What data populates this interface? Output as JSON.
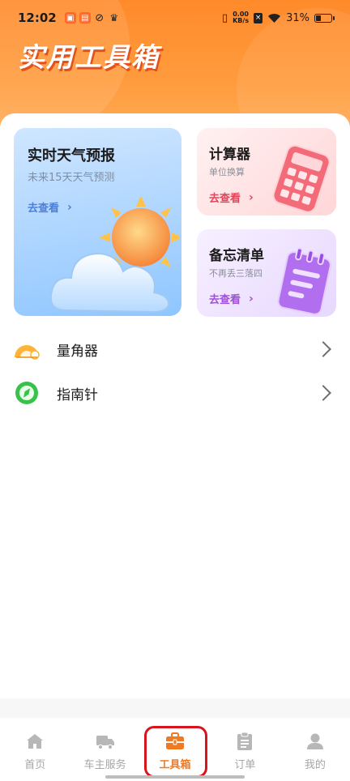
{
  "status_bar": {
    "time": "12:02",
    "net_speed_value": "0.00",
    "net_speed_unit": "KB/s",
    "battery": "31%",
    "battery_level": 0.31
  },
  "header": {
    "title": "实用工具箱",
    "accent_color": "#ff8a2a"
  },
  "cards": {
    "weather": {
      "title": "实时天气预报",
      "subtitle": "未来15天天气预测",
      "link": "去查看"
    },
    "calculator": {
      "title": "计算器",
      "subtitle": "单位换算",
      "link": "去查看"
    },
    "memo": {
      "title": "备忘清单",
      "subtitle": "不再丢三落四",
      "link": "去查看"
    }
  },
  "tools": [
    {
      "label": "量角器",
      "icon": "protractor-icon"
    },
    {
      "label": "指南针",
      "icon": "compass-icon"
    }
  ],
  "bottom_nav": {
    "items": [
      {
        "label": "首页",
        "icon": "home-icon"
      },
      {
        "label": "车主服务",
        "icon": "truck-icon"
      },
      {
        "label": "工具箱",
        "icon": "toolbox-icon",
        "active": true
      },
      {
        "label": "订单",
        "icon": "clipboard-icon"
      },
      {
        "label": "我的",
        "icon": "person-icon"
      }
    ],
    "active_color": "#f07a23"
  }
}
